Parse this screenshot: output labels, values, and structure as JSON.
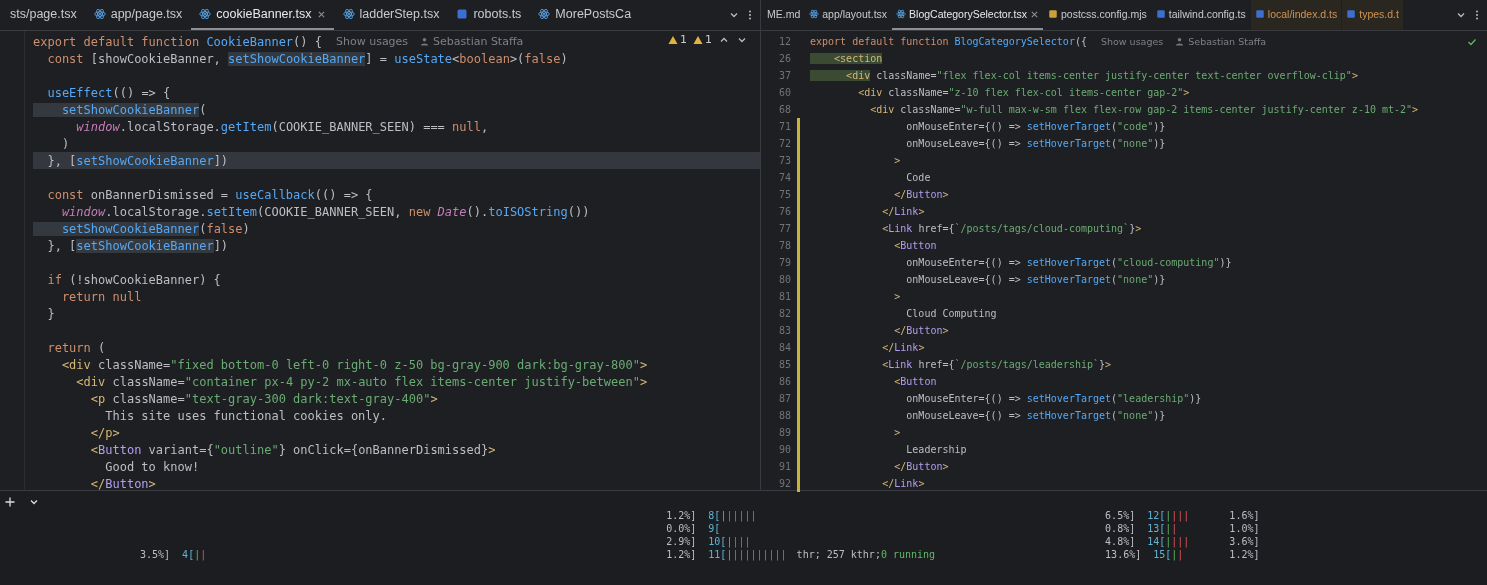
{
  "left_pane": {
    "tabs": [
      {
        "label": "sts/page.tsx",
        "kind": "plain",
        "selected": false,
        "excluded": false
      },
      {
        "label": "app/page.tsx",
        "kind": "react",
        "selected": false,
        "excluded": false
      },
      {
        "label": "cookieBanner.tsx",
        "kind": "react",
        "selected": true,
        "excluded": false
      },
      {
        "label": "ladderStep.tsx",
        "kind": "react",
        "selected": false,
        "excluded": false
      },
      {
        "label": "robots.ts",
        "kind": "ts",
        "selected": false,
        "excluded": false
      },
      {
        "label": "MorePostsCa",
        "kind": "react",
        "selected": false,
        "excluded": false
      }
    ],
    "warnings": [
      "1",
      "1"
    ],
    "lines": [
      {
        "current": false,
        "tokens": [
          {
            "kind": "kw",
            "text": "export default function "
          },
          {
            "kind": "fn",
            "text": "CookieBanner"
          },
          {
            "kind": "p",
            "text": "() {"
          }
        ],
        "hint": {
          "usages": "Show usages",
          "author": "Sebastian Staffa"
        }
      },
      {
        "current": false,
        "tokens": [
          {
            "kind": "kw",
            "text": "  const "
          },
          {
            "kind": "p",
            "text": "[showCookieBanner, "
          },
          {
            "kind": "hl",
            "text": "setShowCookieBanner"
          },
          {
            "kind": "p",
            "text": "] = "
          },
          {
            "kind": "fn",
            "text": "useState"
          },
          {
            "kind": "p",
            "text": "<"
          },
          {
            "kind": "kw",
            "text": "boolean"
          },
          {
            "kind": "p",
            "text": ">("
          },
          {
            "kind": "kw",
            "text": "false"
          },
          {
            "kind": "p",
            "text": ")"
          }
        ]
      },
      {
        "current": false
      },
      {
        "current": false,
        "tokens": [
          {
            "kind": "fn",
            "text": "  useEffect"
          },
          {
            "kind": "p",
            "text": "(() => {"
          }
        ]
      },
      {
        "current": false,
        "tokens": [
          {
            "kind": "hl",
            "text": "    setShowCookieBanner"
          },
          {
            "kind": "p",
            "text": "("
          }
        ]
      },
      {
        "current": false,
        "tokens": [
          {
            "kind": "it",
            "text": "      window"
          },
          {
            "kind": "p",
            "text": ".localStorage."
          },
          {
            "kind": "fn",
            "text": "getItem"
          },
          {
            "kind": "p",
            "text": "(COOKIE_BANNER_SEEN) === "
          },
          {
            "kind": "kw",
            "text": "null"
          },
          {
            "kind": "p",
            "text": ","
          }
        ]
      },
      {
        "current": false,
        "tokens": [
          {
            "kind": "p",
            "text": "    )"
          }
        ]
      },
      {
        "current": true,
        "tokens": [
          {
            "kind": "p",
            "text": "  }, ["
          },
          {
            "kind": "hl",
            "text": "setShowCookieBanner"
          },
          {
            "kind": "p",
            "text": "])"
          }
        ]
      },
      {
        "current": false
      },
      {
        "current": false,
        "tokens": [
          {
            "kind": "kw",
            "text": "  const "
          },
          {
            "kind": "p",
            "text": "onBannerDismissed = "
          },
          {
            "kind": "fn",
            "text": "useCallback"
          },
          {
            "kind": "p",
            "text": "(() => {"
          }
        ]
      },
      {
        "current": false,
        "tokens": [
          {
            "kind": "it",
            "text": "    window"
          },
          {
            "kind": "p",
            "text": ".localStorage."
          },
          {
            "kind": "fn",
            "text": "setItem"
          },
          {
            "kind": "p",
            "text": "(COOKIE_BANNER_SEEN, "
          },
          {
            "kind": "kw",
            "text": "new "
          },
          {
            "kind": "it",
            "text": "Date"
          },
          {
            "kind": "p",
            "text": "()."
          },
          {
            "kind": "fn",
            "text": "toISOString"
          },
          {
            "kind": "p",
            "text": "())"
          }
        ]
      },
      {
        "current": false,
        "tokens": [
          {
            "kind": "hl",
            "text": "    setShowCookieBanner"
          },
          {
            "kind": "p",
            "text": "("
          },
          {
            "kind": "kw",
            "text": "false"
          },
          {
            "kind": "p",
            "text": ")"
          }
        ]
      },
      {
        "current": false,
        "tokens": [
          {
            "kind": "p",
            "text": "  }, ["
          },
          {
            "kind": "hl",
            "text": "setShowCookieBanner"
          },
          {
            "kind": "p",
            "text": "])"
          }
        ]
      },
      {
        "current": false
      },
      {
        "current": false,
        "tokens": [
          {
            "kind": "kw",
            "text": "  if "
          },
          {
            "kind": "p",
            "text": "(!showCookieBanner) {"
          }
        ]
      },
      {
        "current": false,
        "tokens": [
          {
            "kind": "kw",
            "text": "    return null"
          }
        ]
      },
      {
        "current": false,
        "tokens": [
          {
            "kind": "p",
            "text": "  }"
          }
        ]
      },
      {
        "current": false
      },
      {
        "current": false,
        "tokens": [
          {
            "kind": "kw",
            "text": "  return "
          },
          {
            "kind": "p",
            "text": "("
          }
        ]
      },
      {
        "current": false,
        "tokens": [
          {
            "kind": "tag",
            "text": "    <div "
          },
          {
            "kind": "p",
            "text": "className="
          },
          {
            "kind": "str",
            "text": "\"fixed bottom-0 left-0 right-0 z-50 bg-gray-900 dark:bg-gray-800\""
          },
          {
            "kind": "tag",
            "text": ">"
          }
        ]
      },
      {
        "current": false,
        "tokens": [
          {
            "kind": "tag",
            "text": "      <div "
          },
          {
            "kind": "p",
            "text": "className="
          },
          {
            "kind": "str",
            "text": "\"container px-4 py-2 mx-auto flex items-center justify-between\""
          },
          {
            "kind": "tag",
            "text": ">"
          }
        ]
      },
      {
        "current": false,
        "tokens": [
          {
            "kind": "tag",
            "text": "        <p "
          },
          {
            "kind": "p",
            "text": "className="
          },
          {
            "kind": "str",
            "text": "\"text-gray-300 dark:text-gray-400\""
          },
          {
            "kind": "tag",
            "text": ">"
          }
        ]
      },
      {
        "current": false,
        "tokens": [
          {
            "kind": "p",
            "text": "          This site uses functional cookies only."
          }
        ]
      },
      {
        "current": false,
        "tokens": [
          {
            "kind": "tag",
            "text": "        </p>"
          }
        ]
      },
      {
        "current": false,
        "tokens": [
          {
            "kind": "tag",
            "text": "        <"
          },
          {
            "kind": "comp",
            "text": "Button "
          },
          {
            "kind": "p",
            "text": "variant={"
          },
          {
            "kind": "str",
            "text": "\"outline\""
          },
          {
            "kind": "p",
            "text": "} onClick={onBannerDismissed}"
          },
          {
            "kind": "tag",
            "text": ">"
          }
        ]
      },
      {
        "current": false,
        "tokens": [
          {
            "kind": "p",
            "text": "          Good to know!"
          }
        ]
      },
      {
        "current": false,
        "tokens": [
          {
            "kind": "tag",
            "text": "        </"
          },
          {
            "kind": "comp",
            "text": "Button"
          },
          {
            "kind": "tag",
            "text": ">"
          }
        ]
      }
    ]
  },
  "right_pane": {
    "tabs": [
      {
        "label": "ME.md",
        "kind": "plain",
        "selected": false,
        "excluded": false
      },
      {
        "label": "app/layout.tsx",
        "kind": "react",
        "selected": false,
        "excluded": false
      },
      {
        "label": "BlogCategorySelector.tsx",
        "kind": "react",
        "selected": true,
        "excluded": false
      },
      {
        "label": "postcss.config.mjs",
        "kind": "js",
        "selected": false,
        "excluded": false
      },
      {
        "label": "tailwind.config.ts",
        "kind": "ts",
        "selected": false,
        "excluded": false
      },
      {
        "label": "local/index.d.ts",
        "kind": "ts",
        "selected": false,
        "excluded": true
      },
      {
        "label": "types.d.t",
        "kind": "ts",
        "selected": false,
        "excluded": true
      }
    ],
    "lines": [
      {
        "n": "12",
        "modified": false,
        "tokens": [
          {
            "kind": "kw",
            "text": "export default function "
          },
          {
            "kind": "fn",
            "text": "BlogCategorySelector"
          },
          {
            "kind": "p",
            "text": "({"
          }
        ],
        "hint": {
          "usages": "Show usages",
          "author": "Sebastian Staffa"
        }
      },
      {
        "n": "26",
        "modified": false,
        "tokens": [
          {
            "kind": "tagm",
            "text": "    <section"
          }
        ]
      },
      {
        "n": "37",
        "modified": false,
        "tokens": [
          {
            "kind": "tagm",
            "text": "      <div"
          },
          {
            "kind": "p",
            "text": " className="
          },
          {
            "kind": "str",
            "text": "\"flex flex-col items-center justify-center text-center overflow-clip\""
          },
          {
            "kind": "tag",
            "text": ">"
          }
        ]
      },
      {
        "n": "60",
        "modified": false,
        "tokens": [
          {
            "kind": "tag",
            "text": "        <div "
          },
          {
            "kind": "p",
            "text": "className="
          },
          {
            "kind": "str",
            "text": "\"z-10 flex flex-col items-center gap-2\""
          },
          {
            "kind": "tag",
            "text": ">"
          }
        ]
      },
      {
        "n": "68",
        "modified": false,
        "tokens": [
          {
            "kind": "tag",
            "text": "          <div "
          },
          {
            "kind": "p",
            "text": "className="
          },
          {
            "kind": "str",
            "text": "\"w-full max-w-sm flex flex-row gap-2 items-center justify-center z-10 mt-2\""
          },
          {
            "kind": "tag",
            "text": ">"
          }
        ]
      },
      {
        "n": "71",
        "modified": true,
        "tokens": [
          {
            "kind": "p",
            "text": "                onMouseEnter={() => "
          },
          {
            "kind": "fn",
            "text": "setHoverTarget"
          },
          {
            "kind": "p",
            "text": "("
          },
          {
            "kind": "str",
            "text": "\"code\""
          },
          {
            "kind": "p",
            "text": ")}"
          }
        ]
      },
      {
        "n": "72",
        "modified": true,
        "tokens": [
          {
            "kind": "p",
            "text": "                onMouseLeave={() => "
          },
          {
            "kind": "fn",
            "text": "setHoverTarget"
          },
          {
            "kind": "p",
            "text": "("
          },
          {
            "kind": "str",
            "text": "\"none\""
          },
          {
            "kind": "p",
            "text": ")}"
          }
        ]
      },
      {
        "n": "73",
        "modified": true,
        "tokens": [
          {
            "kind": "tag",
            "text": "              >"
          }
        ]
      },
      {
        "n": "74",
        "modified": true,
        "tokens": [
          {
            "kind": "p",
            "text": "                Code"
          }
        ]
      },
      {
        "n": "75",
        "modified": true,
        "tokens": [
          {
            "kind": "tag",
            "text": "              </"
          },
          {
            "kind": "comp",
            "text": "Button"
          },
          {
            "kind": "tag",
            "text": ">"
          }
        ]
      },
      {
        "n": "76",
        "modified": true,
        "tokens": [
          {
            "kind": "tag",
            "text": "            </"
          },
          {
            "kind": "comp",
            "text": "Link"
          },
          {
            "kind": "tag",
            "text": ">"
          }
        ]
      },
      {
        "n": "77",
        "modified": true,
        "tokens": [
          {
            "kind": "tag",
            "text": "            <"
          },
          {
            "kind": "comp",
            "text": "Link "
          },
          {
            "kind": "p",
            "text": "href={"
          },
          {
            "kind": "str",
            "text": "`/posts/tags/cloud-computing`"
          },
          {
            "kind": "p",
            "text": "}"
          },
          {
            "kind": "tag",
            "text": ">"
          }
        ]
      },
      {
        "n": "78",
        "modified": true,
        "tokens": [
          {
            "kind": "tag",
            "text": "              <"
          },
          {
            "kind": "comp",
            "text": "Button"
          }
        ]
      },
      {
        "n": "79",
        "modified": true,
        "tokens": [
          {
            "kind": "p",
            "text": "                onMouseEnter={() => "
          },
          {
            "kind": "fn",
            "text": "setHoverTarget"
          },
          {
            "kind": "p",
            "text": "("
          },
          {
            "kind": "str",
            "text": "\"cloud-computing\""
          },
          {
            "kind": "p",
            "text": ")}"
          }
        ]
      },
      {
        "n": "80",
        "modified": true,
        "tokens": [
          {
            "kind": "p",
            "text": "                onMouseLeave={() => "
          },
          {
            "kind": "fn",
            "text": "setHoverTarget"
          },
          {
            "kind": "p",
            "text": "("
          },
          {
            "kind": "str",
            "text": "\"none\""
          },
          {
            "kind": "p",
            "text": ")}"
          }
        ]
      },
      {
        "n": "81",
        "modified": true,
        "tokens": [
          {
            "kind": "tag",
            "text": "              >"
          }
        ]
      },
      {
        "n": "82",
        "modified": true,
        "tokens": [
          {
            "kind": "p",
            "text": "                Cloud Computing"
          }
        ]
      },
      {
        "n": "83",
        "modified": true,
        "tokens": [
          {
            "kind": "tag",
            "text": "              </"
          },
          {
            "kind": "comp",
            "text": "Button"
          },
          {
            "kind": "tag",
            "text": ">"
          }
        ]
      },
      {
        "n": "84",
        "modified": true,
        "tokens": [
          {
            "kind": "tag",
            "text": "            </"
          },
          {
            "kind": "comp",
            "text": "Link"
          },
          {
            "kind": "tag",
            "text": ">"
          }
        ]
      },
      {
        "n": "85",
        "modified": true,
        "tokens": [
          {
            "kind": "tag",
            "text": "            <"
          },
          {
            "kind": "comp",
            "text": "Link "
          },
          {
            "kind": "p",
            "text": "href={"
          },
          {
            "kind": "str",
            "text": "`/posts/tags/leadership`"
          },
          {
            "kind": "p",
            "text": "}"
          },
          {
            "kind": "tag",
            "text": ">"
          }
        ]
      },
      {
        "n": "86",
        "modified": true,
        "tokens": [
          {
            "kind": "tag",
            "text": "              <"
          },
          {
            "kind": "comp",
            "text": "Button"
          }
        ]
      },
      {
        "n": "87",
        "modified": true,
        "tokens": [
          {
            "kind": "p",
            "text": "                onMouseEnter={() => "
          },
          {
            "kind": "fn",
            "text": "setHoverTarget"
          },
          {
            "kind": "p",
            "text": "("
          },
          {
            "kind": "str",
            "text": "\"leadership\""
          },
          {
            "kind": "p",
            "text": ")}"
          }
        ]
      },
      {
        "n": "88",
        "modified": true,
        "tokens": [
          {
            "kind": "p",
            "text": "                onMouseLeave={() => "
          },
          {
            "kind": "fn",
            "text": "setHoverTarget"
          },
          {
            "kind": "p",
            "text": "("
          },
          {
            "kind": "str",
            "text": "\"none\""
          },
          {
            "kind": "p",
            "text": ")}"
          }
        ]
      },
      {
        "n": "89",
        "modified": true,
        "tokens": [
          {
            "kind": "tag",
            "text": "              >"
          }
        ]
      },
      {
        "n": "90",
        "modified": true,
        "tokens": [
          {
            "kind": "p",
            "text": "                Leadership"
          }
        ]
      },
      {
        "n": "91",
        "modified": true,
        "tokens": [
          {
            "kind": "tag",
            "text": "              </"
          },
          {
            "kind": "comp",
            "text": "Button"
          },
          {
            "kind": "tag",
            "text": ">"
          }
        ]
      },
      {
        "n": "92",
        "modified": true,
        "tokens": [
          {
            "kind": "tag",
            "text": "            </"
          },
          {
            "kind": "comp",
            "text": "Link"
          },
          {
            "kind": "tag",
            "text": ">"
          }
        ]
      }
    ]
  },
  "terminal": {
    "columns": [
      {
        "meters": [
          {
            "pct": "3.5%]",
            "cpu": "4[",
            "bars": "||"
          }
        ]
      },
      {
        "meters": [
          {
            "pct": "1.2%]",
            "cpu": "8[",
            "bars": "||||||"
          },
          {
            "pct": "0.0%]",
            "cpu": "9["
          },
          {
            "pct": "2.9%]",
            "cpu": "10[",
            "bars": "||||"
          },
          {
            "pct": "1.2%]",
            "cpu": "11[",
            "bars": "||||||||||"
          }
        ]
      },
      {
        "meters": [
          {
            "pct": "6.5%]",
            "cpu": "12[",
            "bars": "||||"
          },
          {
            "pct": "0.8%]",
            "cpu": "13[",
            "bars": "||"
          },
          {
            "pct": "4.8%]",
            "cpu": "14[",
            "bars": "||||"
          },
          {
            "pct": "13.6%]",
            "cpu": "15[",
            "bars": "||"
          }
        ]
      },
      {
        "meters": [
          {
            "pct": "1.6%]"
          },
          {
            "pct": "1.0%]"
          },
          {
            "pct": "3.6%]"
          },
          {
            "pct": "1.2%]"
          }
        ]
      }
    ],
    "tasks": "thr; 257 kthr;",
    "running": "0 running"
  }
}
